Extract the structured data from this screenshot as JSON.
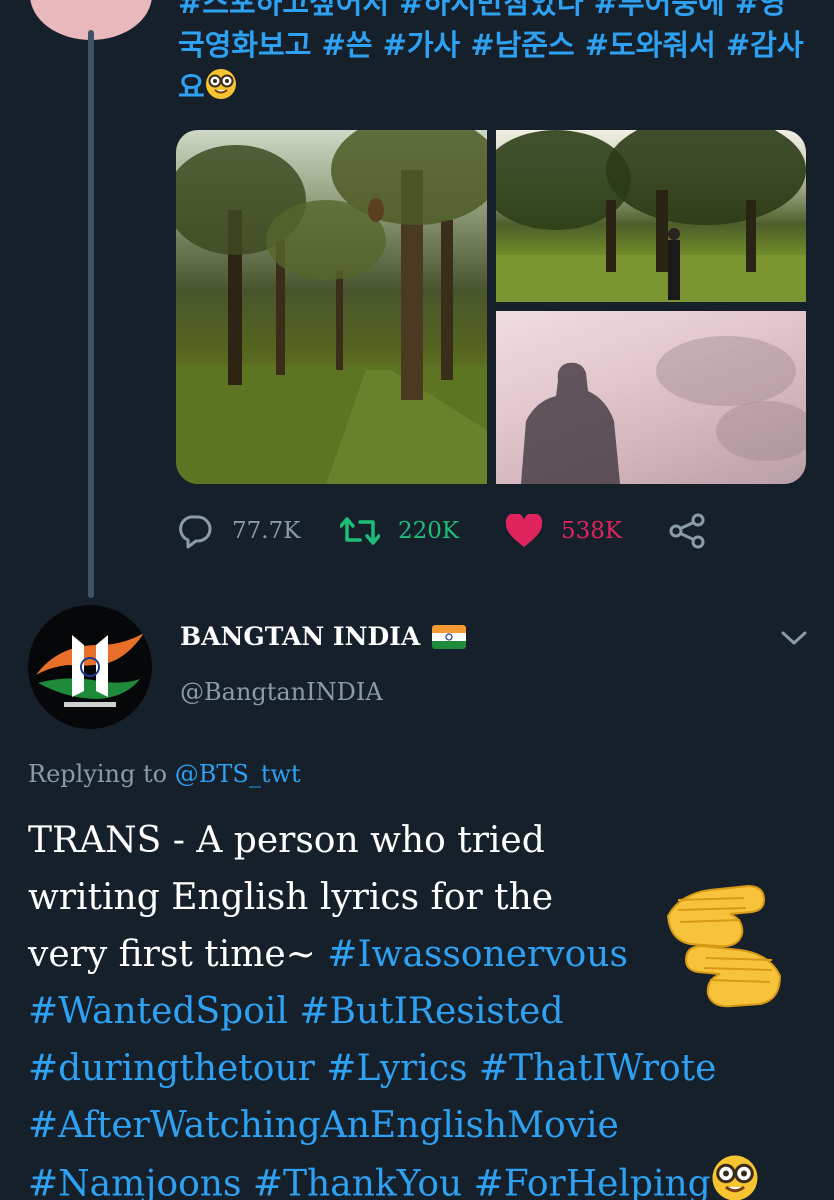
{
  "previous_tweet": {
    "hashtag_lines": [
      "#스포하고싶어서 #하지만참았다 #투어중에 #영",
      "국영화보고 #쓴 #가사 #남준스 #도와줘서 #감사",
      "요"
    ],
    "emoji_icon": "nerd-face-icon",
    "actions": {
      "replies": "77.7K",
      "retweets": "220K",
      "likes": "538K"
    },
    "colors": {
      "link": "#2ea1f2",
      "retweet": "#1fbd78",
      "like": "#e0245e",
      "muted": "#8c9ba8"
    }
  },
  "reply_tweet": {
    "display_name": "BANGTAN INDIA",
    "flag_icon": "india-flag-icon",
    "handle": "@BangtanINDIA",
    "replying_label": "Replying to",
    "replying_to": "@BTS_twt",
    "text_lines": [
      {
        "plain": "TRANS - A person who tried",
        "tags": ""
      },
      {
        "plain": "writing English lyrics for the",
        "tags": ""
      },
      {
        "plain": "very first time~ ",
        "tags": "#Iwassonervous"
      },
      {
        "plain": "",
        "tags": "#WantedSpoil #ButIResisted"
      },
      {
        "plain": "",
        "tags": "#duringthetour #Lyrics #ThatIWrote"
      },
      {
        "plain": "",
        "tags": "#AfterWatchingAnEnglishMovie"
      },
      {
        "plain": "",
        "tags": "#Namjoons #ThankYou #ForHelping"
      }
    ],
    "hands_icon": "palms-up-hands-icon",
    "end_emoji_icon": "nerd-face-icon"
  },
  "theme": {
    "background": "#16202b",
    "thread_line": "#3d5466"
  }
}
